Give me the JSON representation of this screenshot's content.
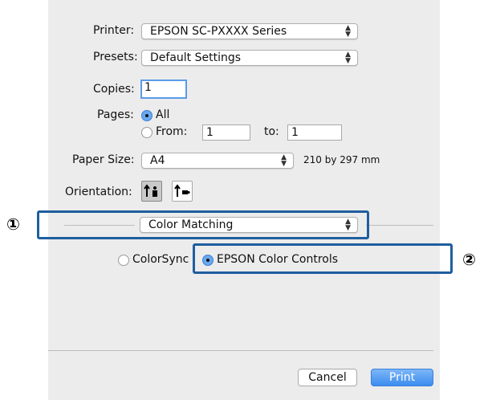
{
  "printer": {
    "label": "Printer:",
    "value": "EPSON SC-PXXXX Series"
  },
  "presets": {
    "label": "Presets:",
    "value": "Default Settings"
  },
  "copies": {
    "label": "Copies:",
    "value": "1"
  },
  "pages": {
    "label": "Pages:",
    "all_label": "All",
    "from_label": "From:",
    "from_value": "1",
    "to_label": "to:",
    "to_value": "1"
  },
  "paper_size": {
    "label": "Paper Size:",
    "value": "A4",
    "dimensions": "210 by 297 mm"
  },
  "orientation": {
    "label": "Orientation:"
  },
  "panel_menu": {
    "value": "Color Matching"
  },
  "color_options": {
    "colorsync": "ColorSync",
    "epson": "EPSON Color Controls"
  },
  "callouts": {
    "one": "①",
    "two": "②"
  },
  "buttons": {
    "cancel": "Cancel",
    "print": "Print"
  },
  "colors": {
    "accent": "#3b8df0",
    "callout": "#1f5e9e",
    "dialog_bg": "#ececec"
  }
}
